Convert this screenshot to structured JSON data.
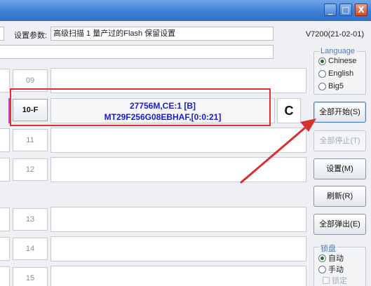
{
  "window": {
    "minimize": "_",
    "maximize": "□",
    "close": "X"
  },
  "header": {
    "params_label": "设置参数:",
    "params_value": "高级扫描 1 量产过的Flash 保留设置",
    "version": "V7200(21-02-01)"
  },
  "slots": [
    {
      "num": "09",
      "line1": "",
      "line2": "",
      "status": ""
    },
    {
      "num": "10-F",
      "line1": "27756M,CE:1 [B]",
      "line2": "MT29F256G08EBHAF,[0:0:21]",
      "status": "C"
    },
    {
      "num": "11",
      "line1": "",
      "line2": "",
      "status": ""
    },
    {
      "num": "12",
      "line1": "",
      "line2": "",
      "status": ""
    },
    {
      "num": "13",
      "line1": "",
      "line2": "",
      "status": ""
    },
    {
      "num": "14",
      "line1": "",
      "line2": "",
      "status": ""
    },
    {
      "num": "15",
      "line1": "",
      "line2": "",
      "status": ""
    }
  ],
  "language": {
    "title": "Language",
    "options": [
      "Chinese",
      "English",
      "Big5"
    ],
    "selected": "Chinese"
  },
  "buttons": {
    "start_all": "全部开始(S)",
    "stop_all": "全部停止(T)",
    "settings": "设置(M)",
    "refresh": "刷新(R)",
    "eject_all": "全部弹出(E)"
  },
  "lock_disk": {
    "title": "锁盘",
    "options": [
      "自动",
      "手动"
    ],
    "selected": "自动",
    "lock_label": "锁定"
  },
  "colors": {
    "highlight": "#e03030",
    "info_text": "#1a1ad0",
    "titlebar": "#3d7fd6"
  }
}
